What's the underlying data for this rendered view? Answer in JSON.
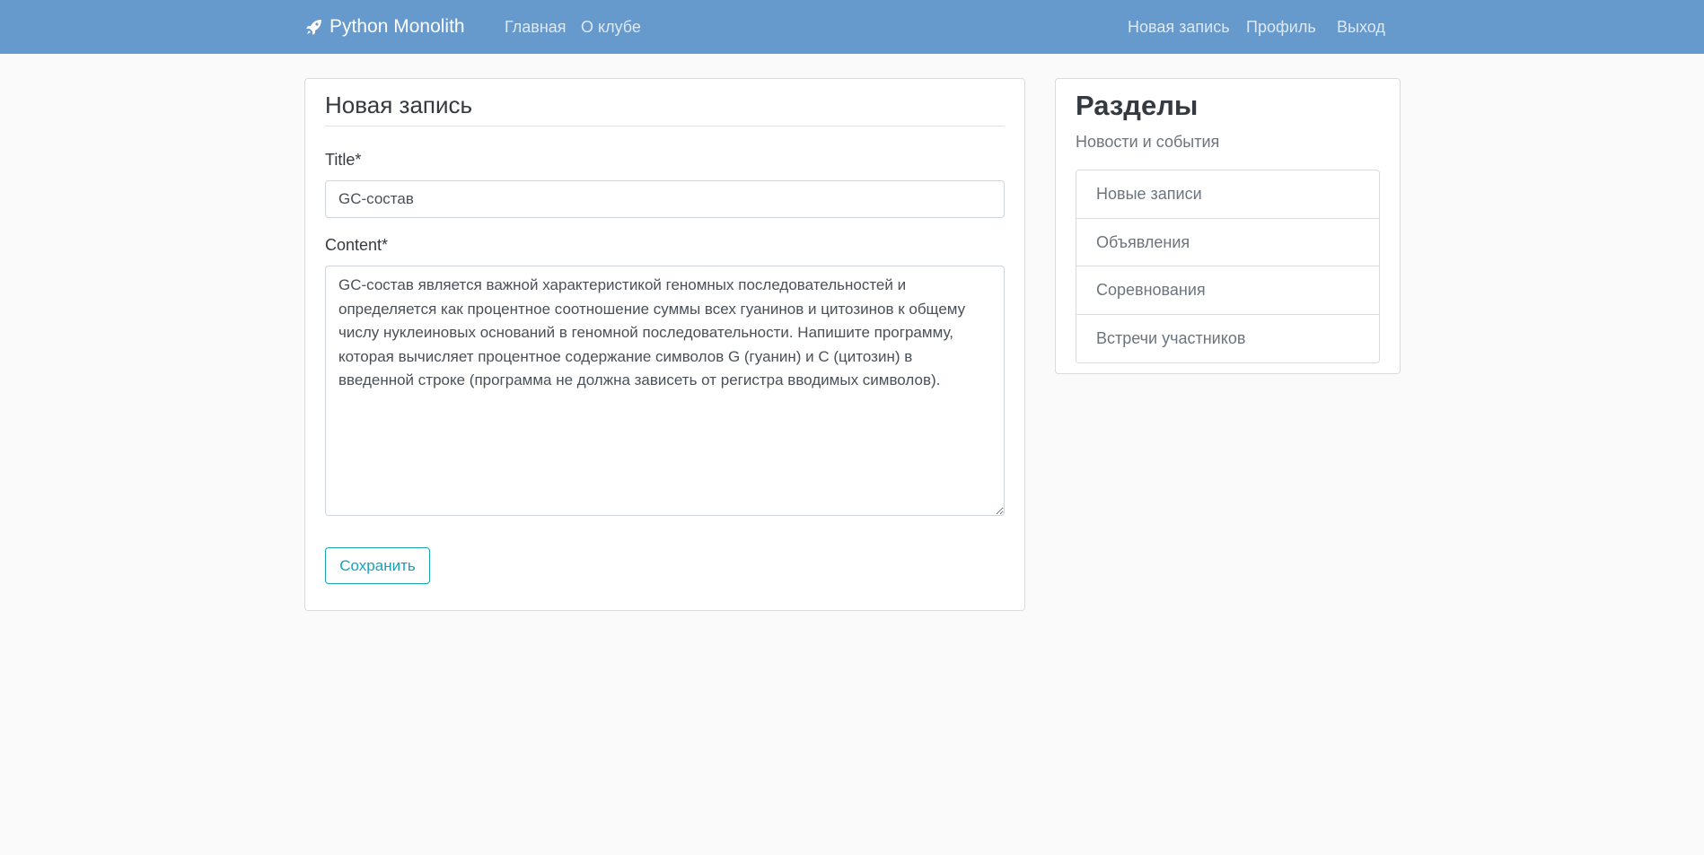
{
  "navbar": {
    "brand_label": "Python Monolith",
    "brand_icon": "rocket-icon",
    "left_links": [
      "Главная",
      "О клубе"
    ],
    "right_links": [
      "Новая запись",
      "Профиль",
      "Выход"
    ],
    "colors": {
      "background": "#6699cc",
      "text": "#ffffff"
    }
  },
  "form": {
    "heading": "Новая запись",
    "title_label": "Title*",
    "title_value": "GC-состав",
    "content_label": "Content*",
    "content_value": "GC-состав является важной характеристикой геномных последовательностей и определяется как процентное соотношение суммы всех гуанинов и цитозинов к общему числу нуклеиновых оснований в геномной последовательности. Напишите программу, которая вычисляет процентное содержание символов G (гуанин) и C (цитозин) в введенной строке (программа не должна зависеть от регистра вводимых символов).",
    "save_label": "Сохранить",
    "accent_color": "#17a2b8"
  },
  "sidebar": {
    "title": "Разделы",
    "subtitle": "Новости и события",
    "items": [
      {
        "label": "Новые записи"
      },
      {
        "label": "Объявления"
      },
      {
        "label": "Соревнования"
      },
      {
        "label": "Встречи участников"
      }
    ]
  }
}
